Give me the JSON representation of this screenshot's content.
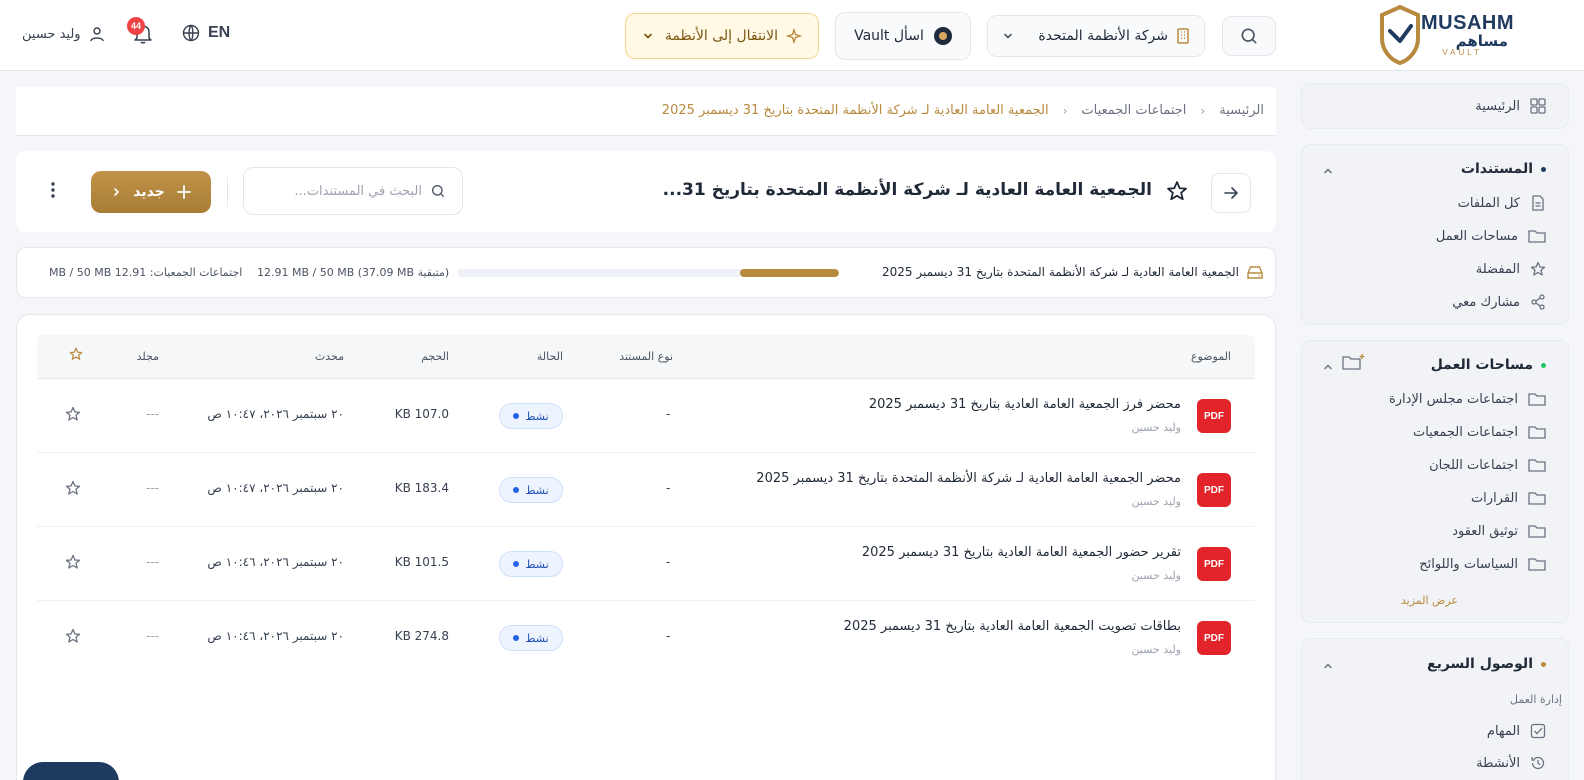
{
  "brand": {
    "name": "MUSAHM",
    "arabic": "مساهم",
    "sub": "VAULT"
  },
  "topbar": {
    "company": "شركة الأنظمة المتحدة",
    "ask": "اسأل Vault",
    "go_systems": "الانتقال إلى الأنظمة",
    "lang": "EN",
    "notifications": "44",
    "user": "وليد حسين"
  },
  "breadcrumb": {
    "home": "الرئيسية",
    "section": "اجتماعات الجمعيات",
    "current": "الجمعية العامة العادية لـ شركة الأنظمة المتحدة بتاريخ 31 ديسمبر 2025"
  },
  "header": {
    "title": "الجمعية العامة العادية لـ شركة الأنظمة المتحدة بتاريخ 31...",
    "search_placeholder": "البحث في المستندات...",
    "new_label": "جديد"
  },
  "storage": {
    "name": "الجمعية العامة العادية لـ شركة الأنظمة المتحدة بتاريخ 31 ديسمبر 2025",
    "usage": "12.91 MB / 50 MB (37.09 MB متبقية)",
    "fill_fraction": 0.258,
    "group": "اجتماعات الجمعيات: 12.91 MB / 50 MB"
  },
  "table": {
    "columns": {
      "subject": "الموضوع",
      "doc_type": "نوع المستند",
      "status": "الحالة",
      "size": "الحجم",
      "updated": "محدث",
      "folder": "مجلد"
    },
    "rows": [
      {
        "badge": "PDF",
        "name": "محضر فرز الجمعية العامة العادية بتاريخ 31 ديسمبر 2025",
        "author": "وليد حسين",
        "type": "-",
        "status": "نشط",
        "size": "107.0 KB",
        "updated": "٢٠ سبتمبر ٢٠٢٦، ١٠:٤٧ ص",
        "folder": "---"
      },
      {
        "badge": "PDF",
        "name": "محضر الجمعية العامة العادية لـ شركة الأنظمة المتحدة بتاريخ 31 ديسمبر 2025",
        "author": "وليد حسين",
        "type": "-",
        "status": "نشط",
        "size": "183.4 KB",
        "updated": "٢٠ سبتمبر ٢٠٢٦، ١٠:٤٧ ص",
        "folder": "---"
      },
      {
        "badge": "PDF",
        "name": "تقرير حضور الجمعية العامة العادية بتاريخ 31 ديسمبر 2025",
        "author": "وليد حسين",
        "type": "-",
        "status": "نشط",
        "size": "101.5 KB",
        "updated": "٢٠ سبتمبر ٢٠٢٦، ١٠:٤٦ ص",
        "folder": "---"
      },
      {
        "badge": "PDF",
        "name": "بطاقات تصويت الجمعية العامة العادية بتاريخ 31 ديسمبر 2025",
        "author": "وليد حسين",
        "type": "-",
        "status": "نشط",
        "size": "274.8 KB",
        "updated": "٢٠ سبتمبر ٢٠٢٦، ١٠:٤٦ ص",
        "folder": "---"
      }
    ]
  },
  "sidebar": {
    "home": "الرئيسية",
    "documents": {
      "title": "المستندات",
      "items": [
        "كل الملفات",
        "مساحات العمل",
        "المفضلة",
        "مشارك معي"
      ]
    },
    "workspaces": {
      "title": "مساحات العمل",
      "items": [
        "اجتماعات مجلس الإدارة",
        "اجتماعات الجمعيات",
        "اجتماعات اللجان",
        "القرارات",
        "توثيق العقود",
        "السياسات واللوائح"
      ],
      "more": "عرض المزيد"
    },
    "quick": {
      "title": "الوصول السريع",
      "subtitle": "إدارة العمل",
      "items": [
        "المهام",
        "الأنشطة"
      ]
    }
  },
  "colors": {
    "brand_gold": "#b88a3e",
    "navy": "#1e3a5f",
    "pdf_red": "#e3242b",
    "active_blue": "#2563eb"
  }
}
